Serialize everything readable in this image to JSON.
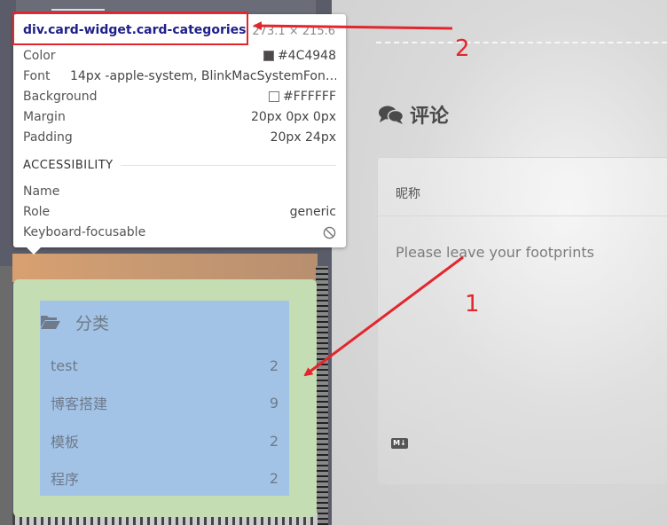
{
  "devtools_tooltip": {
    "selector": "div.card-widget.card-categories",
    "dimensions": "273.1 × 215.6",
    "rows": [
      {
        "label": "Color",
        "value": "#4C4948",
        "swatch": "#4C4948"
      },
      {
        "label": "Font",
        "value": "14px -apple-system, BlinkMacSystemFon…"
      },
      {
        "label": "Background",
        "value": "#FFFFFF",
        "swatch": "#FFFFFF"
      },
      {
        "label": "Margin",
        "value": "20px 0px 0px"
      },
      {
        "label": "Padding",
        "value": "20px 24px"
      }
    ],
    "accessibility": {
      "section_title": "ACCESSIBILITY",
      "name_label": "Name",
      "name_value": "",
      "role_label": "Role",
      "role_value": "generic",
      "focusable_label": "Keyboard-focusable",
      "focusable_icon": "not-allowed-icon"
    }
  },
  "categories_card": {
    "title": "分类",
    "icon": "folder-open-icon",
    "items": [
      {
        "name": "test",
        "count": "2"
      },
      {
        "name": "博客搭建",
        "count": "9"
      },
      {
        "name": "模板",
        "count": "2"
      },
      {
        "name": "程序",
        "count": "2"
      }
    ]
  },
  "comments": {
    "title": "评论",
    "icon": "comments-icon",
    "nickname_label": "昵称",
    "placeholder": "Please leave your footprints",
    "markdown_badge": "M↓"
  },
  "annotations": {
    "label_1": "1",
    "label_2": "2",
    "color": "#E3262D"
  },
  "colors": {
    "margin_highlight": "#C5DDB3",
    "content_highlight": "#A3C3E6"
  }
}
